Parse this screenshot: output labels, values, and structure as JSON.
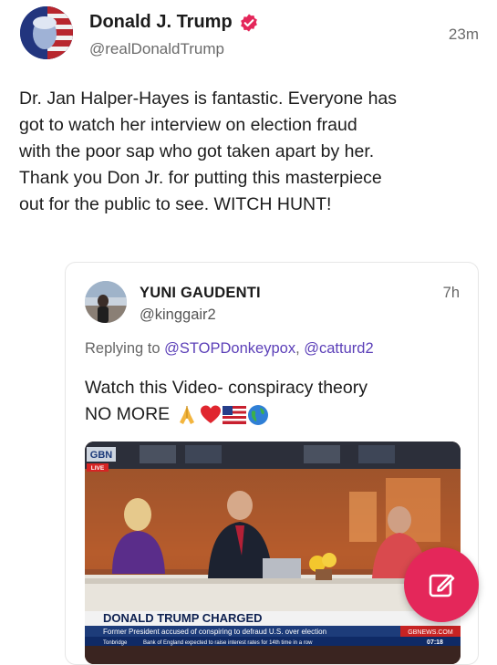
{
  "post": {
    "author_name": "Donald J. Trump",
    "handle": "@realDonaldTrump",
    "time": "23m",
    "text_lines": [
      "Dr. Jan Halper-Hayes is fantastic. Everyone has",
      "got to watch her interview on election fraud",
      "with the poor sap who got taken apart by her.",
      "Thank you Don Jr. for putting this masterpiece",
      "out for the public to see. WITCH HUNT!"
    ]
  },
  "quoted": {
    "author_name": "YUNI GAUDENTI",
    "handle": "@kinggair2",
    "time": "7h",
    "replying_prefix": "Replying to ",
    "mention_1": "@STOPDonkeypox",
    "mention_sep": ", ",
    "mention_2": "@catturd2",
    "text_line_1": "Watch this Video- conspiracy theory",
    "text_line_2": "NO MORE",
    "video": {
      "channel_logo": "GBN",
      "live_label": "LIVE",
      "headline": "DONALD TRUMP CHARGED",
      "subheadline": "Former President accused of conspiring to defraud U.S. over election",
      "network_tag": "GBNEWS.COM",
      "ticker_label": "Tonbridge",
      "ticker_text": "Bank of England expected to raise interest rates for 14th time in a row",
      "clock": "07:18"
    }
  },
  "icons": {
    "verified": "verified-badge-icon",
    "compose": "compose-edit-icon",
    "emojis": [
      "folded-hands-icon",
      "red-heart-icon",
      "us-flag-icon",
      "globe-icon"
    ]
  },
  "colors": {
    "verified_badge": "#e4275a",
    "fab": "#e4275a",
    "mention": "#5b3fb8"
  }
}
